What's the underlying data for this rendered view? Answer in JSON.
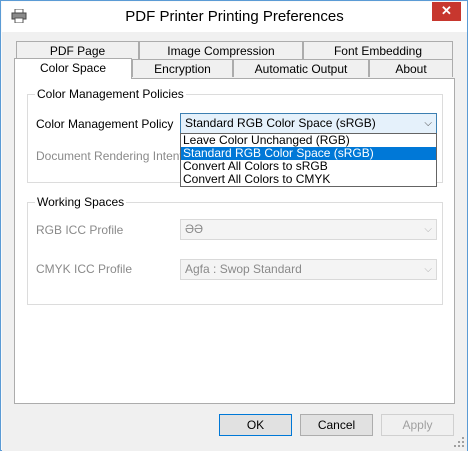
{
  "window": {
    "title": "PDF Printer Printing Preferences",
    "close_label": "✕"
  },
  "tabs": {
    "row1": [
      {
        "label": "PDF Page"
      },
      {
        "label": "Image Compression"
      },
      {
        "label": "Font Embedding"
      }
    ],
    "row2": [
      {
        "label": "Color Space",
        "active": true
      },
      {
        "label": "Encryption"
      },
      {
        "label": "Automatic Output"
      },
      {
        "label": "About"
      }
    ]
  },
  "color_management": {
    "group_title": "Color Management Policies",
    "policy_label": "Color Management Policy",
    "policy_value": "Standard RGB Color Space (sRGB)",
    "rendering_label": "Document Rendering Intent",
    "policy_options": [
      "Leave Color Unchanged (RGB)",
      "Standard RGB Color Space (sRGB)",
      "Convert All Colors to sRGB",
      "Convert All Colors to CMYK"
    ],
    "selected_index": 1
  },
  "working_spaces": {
    "group_title": "Working Spaces",
    "rgb_label": "RGB ICC Profile",
    "rgb_value": "ƏƏ",
    "cmyk_label": "CMYK ICC Profile",
    "cmyk_value": "Agfa : Swop Standard"
  },
  "buttons": {
    "ok": "OK",
    "cancel": "Cancel",
    "apply": "Apply"
  },
  "colors": {
    "accent": "#0078d7",
    "close": "#c7372e"
  }
}
